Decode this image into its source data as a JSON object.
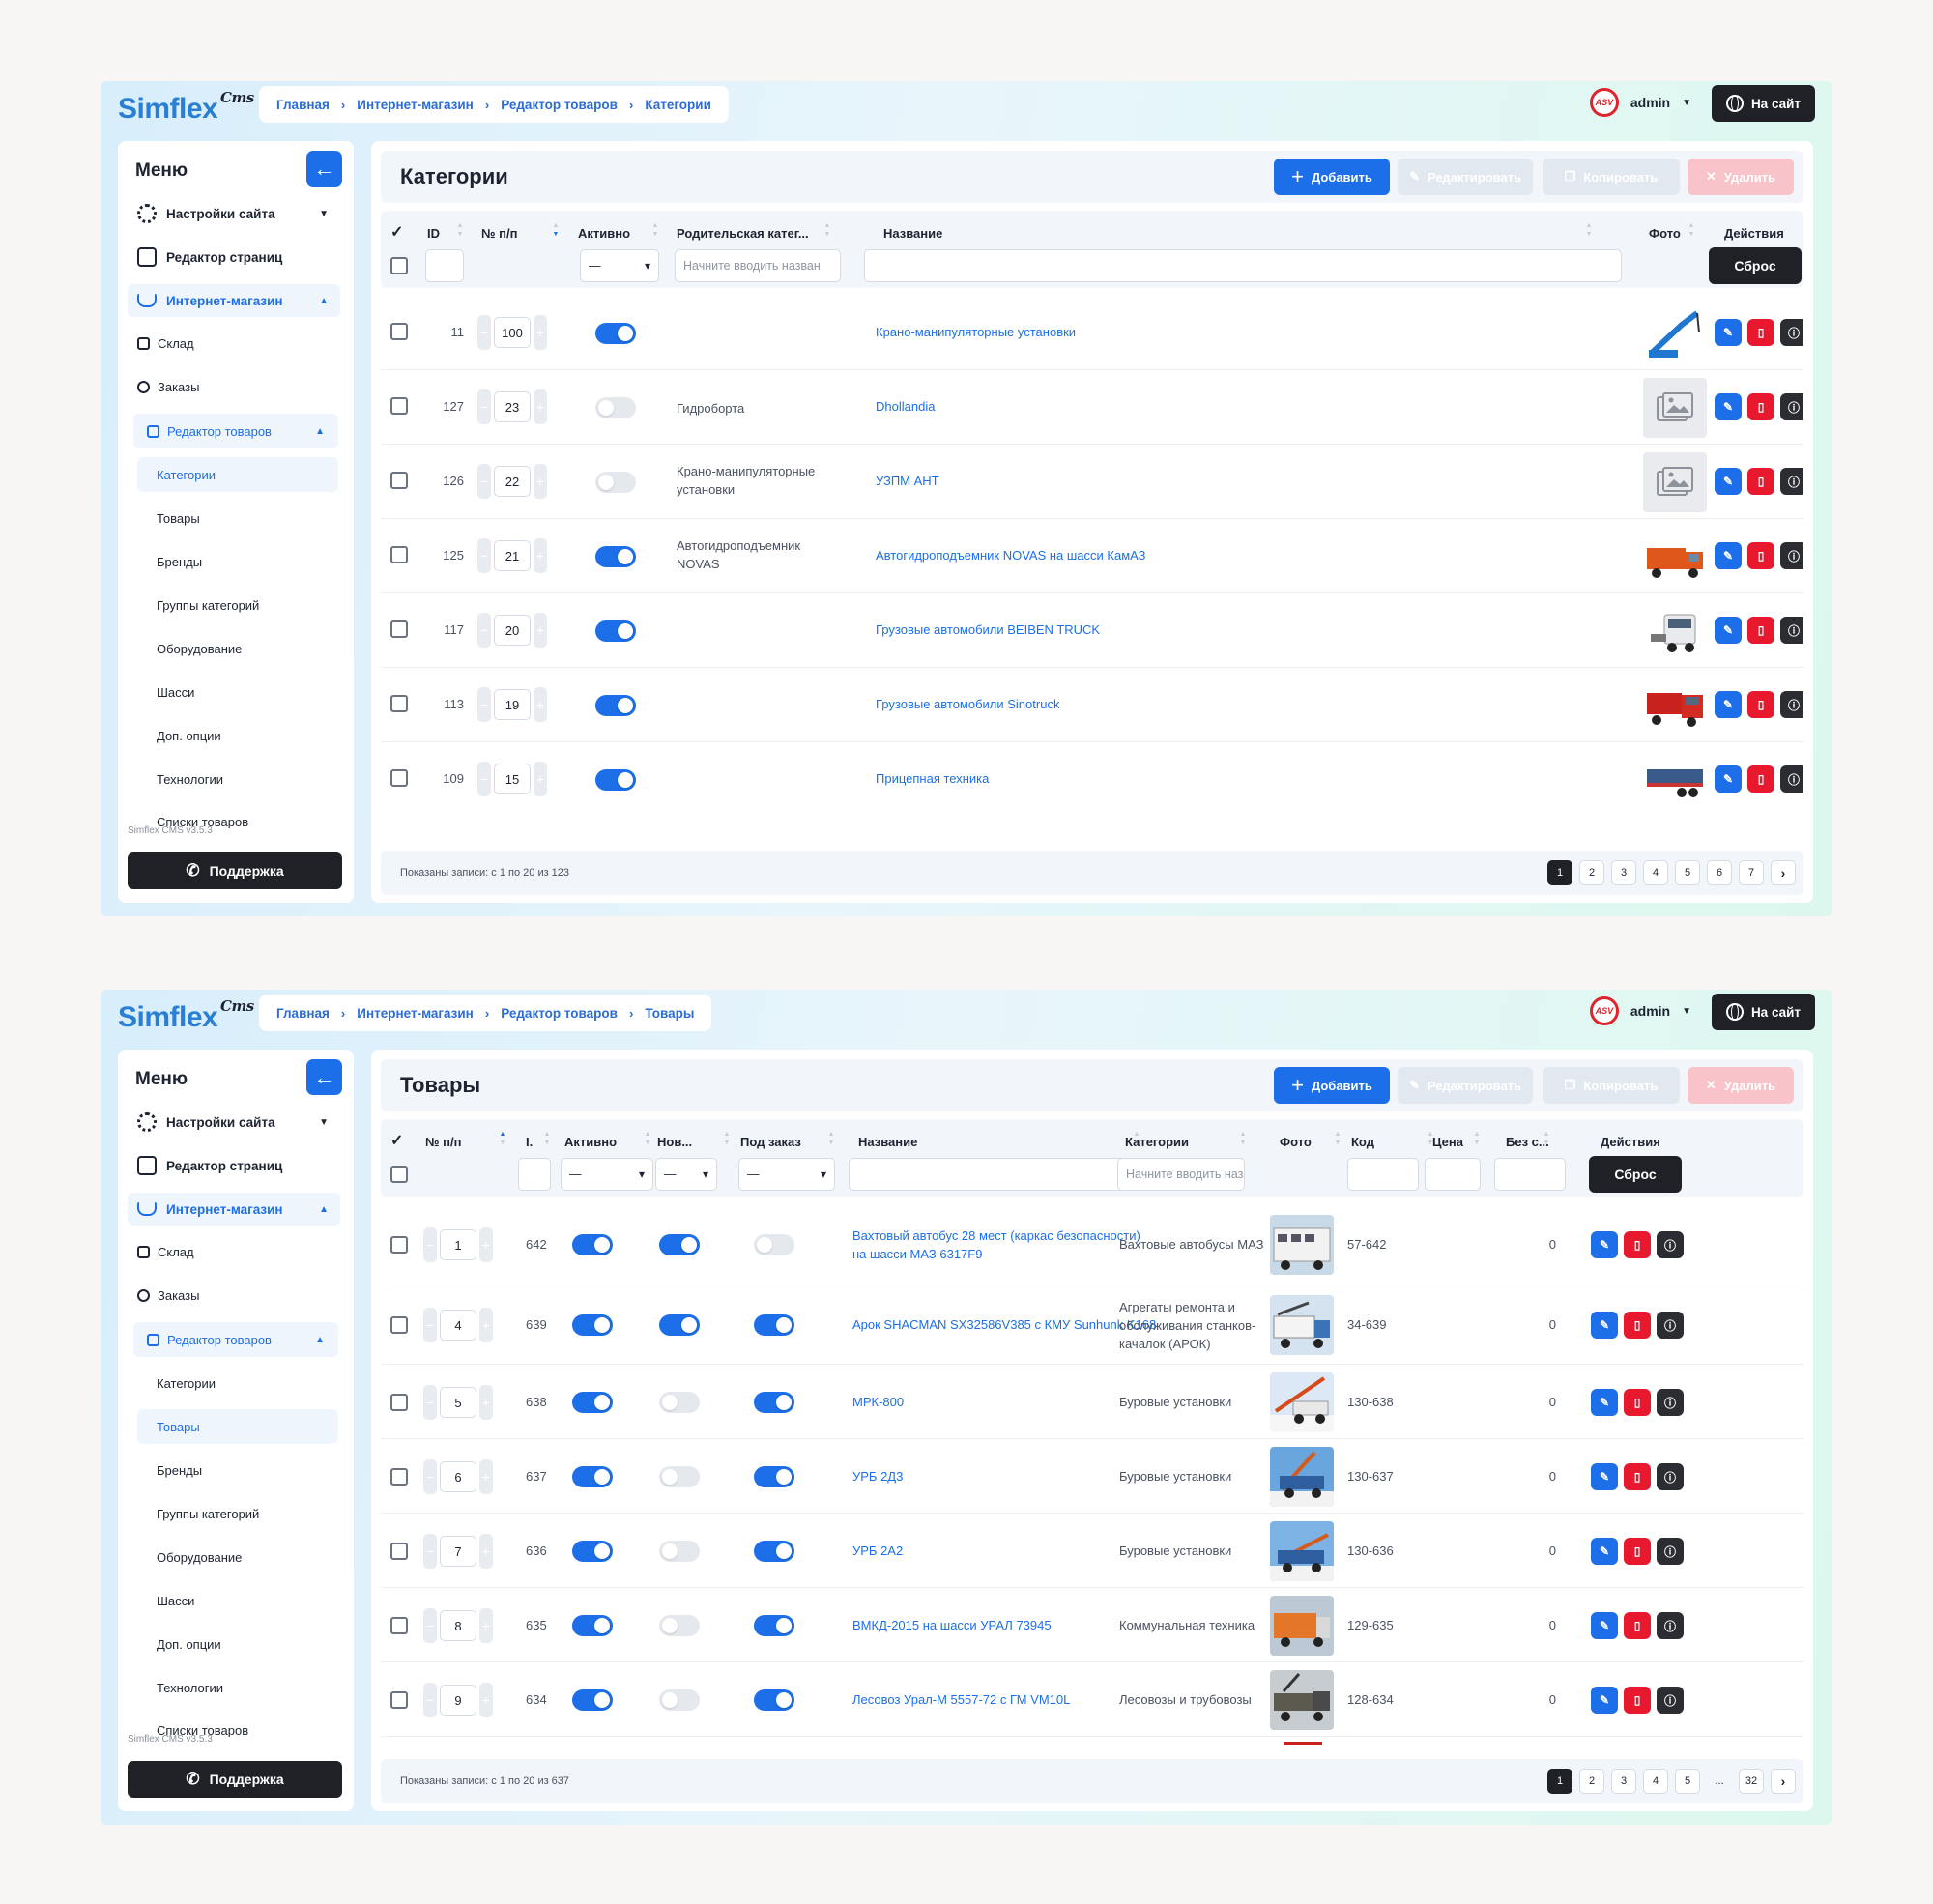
{
  "common": {
    "logo": "Simflex",
    "logo_sup": "Cms",
    "crumbs": [
      "Главная",
      "Интернет-магазин",
      "Редактор товаров"
    ],
    "user": "admin",
    "site_btn": "На сайт",
    "menu_title": "Меню",
    "menu": {
      "settings": "Настройки сайта",
      "pages": "Редактор страниц",
      "shop": "Интернет-магазин",
      "warehouse": "Склад",
      "orders": "Заказы",
      "editor": "Редактор товаров",
      "sub": [
        "Категории",
        "Товары",
        "Бренды",
        "Группы категорий",
        "Оборудование",
        "Шасси",
        "Доп. опции",
        "Технологии",
        "Списки товаров"
      ]
    },
    "version": "Simflex CMS v3.5.3",
    "support": "Поддержка",
    "actions": {
      "add": "Добавить",
      "edit": "Редактировать",
      "copy": "Копировать",
      "delete": "Удалить"
    },
    "reset": "Сброс",
    "filter_placeholder": "Начните вводить назван",
    "select_dash": "—",
    "colors": {
      "accent": "#1c6fe8",
      "danger": "#e8182f",
      "dark": "#1f2126"
    }
  },
  "categories": {
    "crumb_current": "Категории",
    "title": "Категории",
    "columns": {
      "id": "ID",
      "pos": "№ п/п",
      "active": "Активно",
      "parent": "Родительская катег...",
      "name": "Название",
      "photo": "Фото",
      "actions": "Действия"
    },
    "rows": [
      {
        "id": "11",
        "pos": "100",
        "active": true,
        "parent": "",
        "name": "Крано-манипуляторные установки",
        "photo": "crane"
      },
      {
        "id": "127",
        "pos": "23",
        "active": false,
        "parent": "Гидроборта",
        "name": "Dhollandia",
        "photo": "placeholder"
      },
      {
        "id": "126",
        "pos": "22",
        "active": false,
        "parent": "Крано-манипуляторные установки",
        "name": "УЗПМ АНТ",
        "photo": "placeholder"
      },
      {
        "id": "125",
        "pos": "21",
        "active": true,
        "parent": "Автогидроподъемник NOVAS",
        "name": "Автогидроподъемник NOVAS на шасси КамАЗ",
        "photo": "truck-orange"
      },
      {
        "id": "117",
        "pos": "20",
        "active": true,
        "parent": "",
        "name": "Грузовые автомобили BEIBEN TRUCK",
        "photo": "truck-white"
      },
      {
        "id": "113",
        "pos": "19",
        "active": true,
        "parent": "",
        "name": "Грузовые автомобили Sinotruck",
        "photo": "truck-red"
      },
      {
        "id": "109",
        "pos": "15",
        "active": true,
        "parent": "",
        "name": "Прицепная техника",
        "photo": "trailer"
      }
    ],
    "records": "Показаны записи: с 1 по 20 из 123",
    "pages": [
      "1",
      "2",
      "3",
      "4",
      "5",
      "6",
      "7"
    ]
  },
  "products": {
    "crumb_current": "Товары",
    "title": "Товары",
    "columns": {
      "pos": "№ п/п",
      "id": "I.",
      "active": "Активно",
      "new": "Нов...",
      "order": "Под заказ",
      "name": "Название",
      "category": "Категории",
      "photo": "Фото",
      "code": "Код",
      "price": "Цена",
      "nodisc": "Без с...",
      "actions": "Действия"
    },
    "rows": [
      {
        "pos": "1",
        "id": "642",
        "active": true,
        "new": true,
        "order": false,
        "name": "Вахтовый автобус 28 мест (каркас безопасности) на шасси МАЗ 6317F9",
        "category": "Вахтовые автобусы МАЗ",
        "code": "57-642",
        "nodisc": "0",
        "photo": "bus"
      },
      {
        "pos": "4",
        "id": "639",
        "active": true,
        "new": true,
        "order": true,
        "name": "Арок SHACMAN SX32586V385 с КМУ Sunhunk K168",
        "category": "Агрегаты ремонта и обслуживания станков-качалок (АРОК)",
        "code": "34-639",
        "nodisc": "0",
        "photo": "arok"
      },
      {
        "pos": "5",
        "id": "638",
        "active": true,
        "new": false,
        "order": true,
        "name": "МРК-800",
        "category": "Буровые установки",
        "code": "130-638",
        "nodisc": "0",
        "photo": "drill1"
      },
      {
        "pos": "6",
        "id": "637",
        "active": true,
        "new": false,
        "order": true,
        "name": "УРБ 2Д3",
        "category": "Буровые установки",
        "code": "130-637",
        "nodisc": "0",
        "photo": "drill2"
      },
      {
        "pos": "7",
        "id": "636",
        "active": true,
        "new": false,
        "order": true,
        "name": "УРБ 2А2",
        "category": "Буровые установки",
        "code": "130-636",
        "nodisc": "0",
        "photo": "drill3"
      },
      {
        "pos": "8",
        "id": "635",
        "active": true,
        "new": false,
        "order": true,
        "name": "ВМКД-2015 на шасси УРАЛ 73945",
        "category": "Коммунальная техника",
        "code": "129-635",
        "nodisc": "0",
        "photo": "communal"
      },
      {
        "pos": "9",
        "id": "634",
        "active": true,
        "new": false,
        "order": true,
        "name": "Лесовоз Урал-М 5557-72 с ГМ VM10L",
        "category": "Лесовозы и трубовозы",
        "code": "128-634",
        "nodisc": "0",
        "photo": "timber"
      }
    ],
    "records": "Показаны записи: с 1 по 20 из 637",
    "pages": [
      "1",
      "2",
      "3",
      "4",
      "5",
      "...",
      "32"
    ]
  }
}
